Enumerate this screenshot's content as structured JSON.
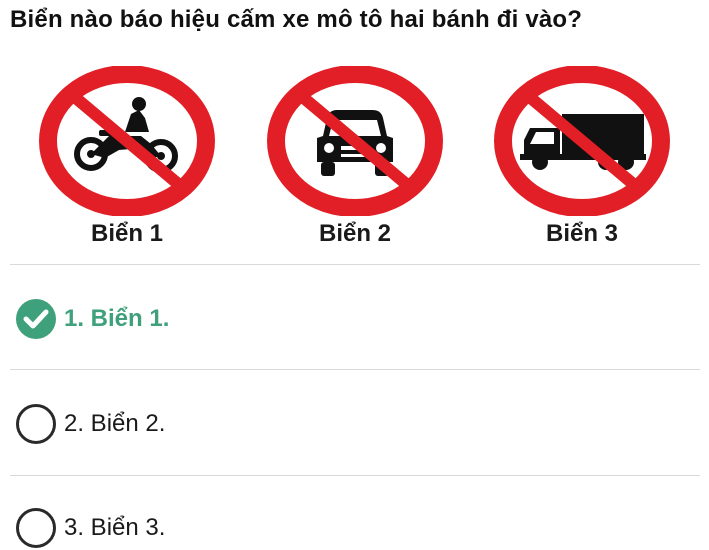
{
  "question": "Biển nào báo hiệu cấm xe mô tô hai bánh đi vào?",
  "signs": [
    {
      "caption": "Biển 1",
      "icon": "motorcycle-icon"
    },
    {
      "caption": "Biển 2",
      "icon": "car-icon"
    },
    {
      "caption": "Biển 3",
      "icon": "truck-icon"
    }
  ],
  "options": [
    {
      "label": "1. Biển 1.",
      "state": "correct"
    },
    {
      "label": "2. Biển 2.",
      "state": "unselected"
    },
    {
      "label": "3. Biển 3.",
      "state": "unselected"
    }
  ],
  "colors": {
    "sign_red": "#e21f26",
    "correct_green": "#3fa17c",
    "divider": "#d9d9d9"
  }
}
